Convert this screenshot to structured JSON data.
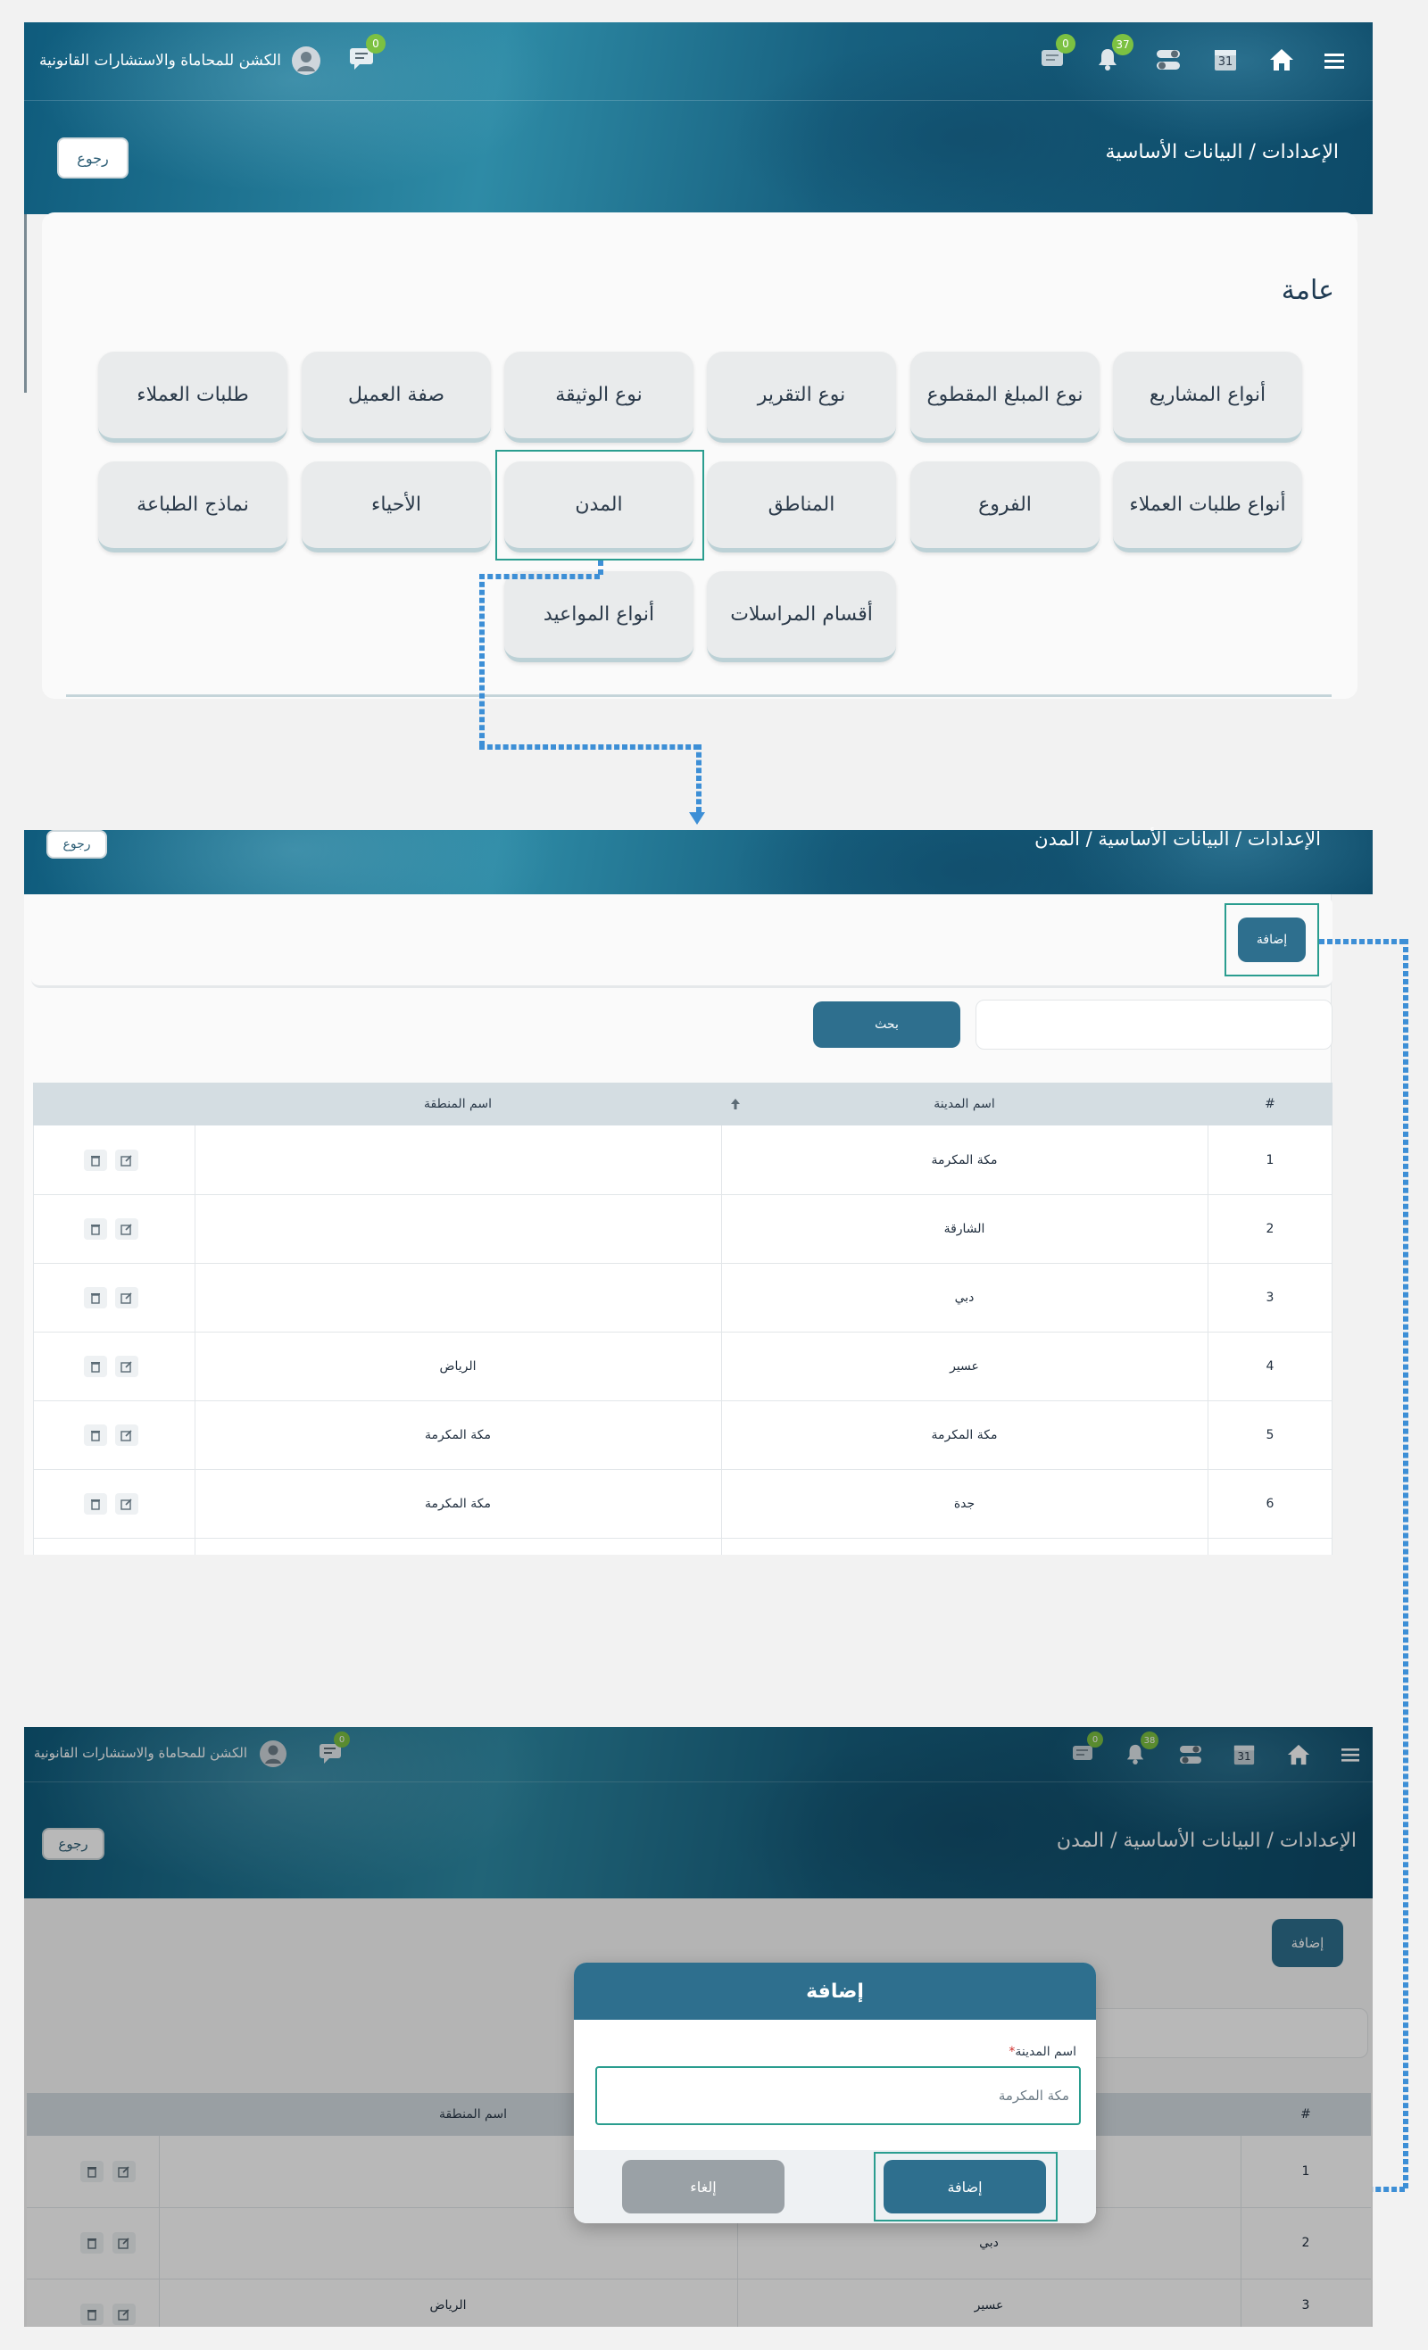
{
  "colors": {
    "header_teal": "#17607f",
    "primary_button": "#2e6f8e",
    "badge_green": "#7cc142",
    "highlight": "#2a9d8f",
    "connector": "#3d8fd6"
  },
  "header": {
    "firm_name": "الكشن للمحاماة والاستشارات القانونية",
    "chat_badge": "0",
    "notes_badge": "0",
    "bell_badge": "37",
    "calendar_day": "31",
    "icons": [
      "menu-icon",
      "home-icon",
      "calendar-icon",
      "toggle-icon",
      "bell-icon",
      "notes-icon",
      "chat-icon",
      "avatar-icon"
    ]
  },
  "screen1": {
    "back_label": "رجوع",
    "breadcrumb": "الإعدادات / البيانات الأساسية",
    "section_title": "عامة",
    "tiles": [
      "أنواع المشاريع",
      "نوع المبلغ المقطوع",
      "نوع التقرير",
      "نوع الوثيقة",
      "صفة العميل",
      "طلبات العملاء",
      "أنواع طلبات العملاء",
      "الفروع",
      "المناطق",
      "المدن",
      "الأحياء",
      "نماذج الطباعة",
      "أقسام المراسلات",
      "أنواع المواعيد"
    ]
  },
  "screen2": {
    "back_label": "رجوع",
    "breadcrumb": "الإعدادات / البيانات الأساسية / المدن",
    "add_label": "إضافة",
    "search_label": "بحث",
    "columns": {
      "num": "#",
      "city": "اسم المدينة",
      "region": "اسم المنطقة"
    },
    "rows": [
      {
        "num": "1",
        "city": "مكة المكرمة",
        "region": ""
      },
      {
        "num": "2",
        "city": "الشارقة",
        "region": ""
      },
      {
        "num": "3",
        "city": "دبي",
        "region": ""
      },
      {
        "num": "4",
        "city": "عسير",
        "region": "الرياض"
      },
      {
        "num": "5",
        "city": "مكة المكرمة",
        "region": "مكة المكرمة"
      },
      {
        "num": "6",
        "city": "جدة",
        "region": "مكة المكرمة"
      }
    ]
  },
  "screen3": {
    "chat_badge": "0",
    "notes_badge": "0",
    "bell_badge": "38",
    "calendar_day": "31",
    "back_label": "رجوع",
    "breadcrumb": "الإعدادات / البيانات الأساسية / المدن",
    "add_label": "إضافة",
    "columns": {
      "num": "#",
      "region": "اسم المنطقة"
    },
    "rows": [
      {
        "num": "1",
        "city": "",
        "region": ""
      },
      {
        "num": "2",
        "city": "دبي",
        "region": ""
      },
      {
        "num": "3",
        "city": "عسير",
        "region": "الرياض"
      }
    ],
    "modal": {
      "title": "إضافة",
      "field_label": "اسم المدينة",
      "required_mark": "*",
      "field_value": "مكة المكرمة",
      "submit_label": "إضافة",
      "cancel_label": "إلغاء"
    }
  }
}
